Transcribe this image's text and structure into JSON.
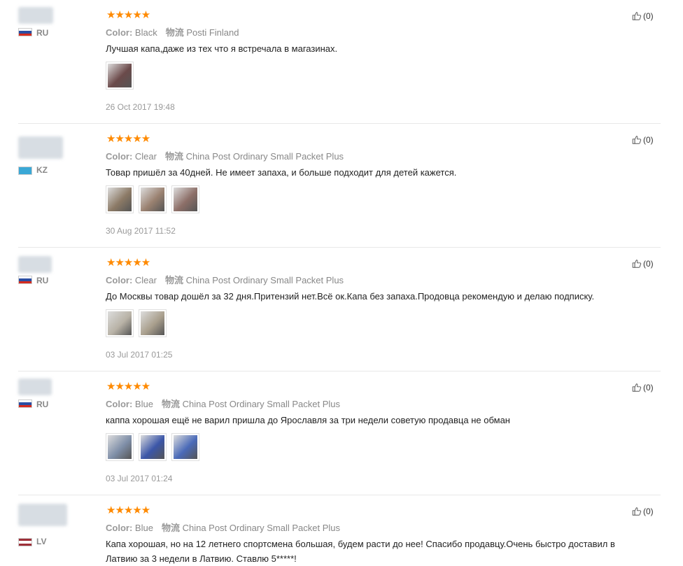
{
  "labels": {
    "color": "Color:",
    "logistics": "物流"
  },
  "icons": {
    "like": "thumbs-up-icon",
    "star": "star-icon"
  },
  "colors": {
    "star": "#ff8a00"
  },
  "reviews": [
    {
      "country": "RU",
      "flag": [
        "#ffffff",
        "#2a4ea3",
        "#d52b1e"
      ],
      "rating": "★★★★★",
      "color": "Black",
      "shipping": "Posti Finland",
      "text": "Лучшая капа,даже из тех что я встречала в магазинах.",
      "photos": [
        "#6b4a4a"
      ],
      "date": "26 Oct 2017 19:48",
      "likes": "(0)"
    },
    {
      "country": "KZ",
      "flag": [
        "#3aa8d6",
        "#3aa8d6",
        "#3aa8d6"
      ],
      "rating": "★★★★★",
      "color": "Clear",
      "shipping": "China Post Ordinary Small Packet Plus",
      "text": "Товар пришёл за 40дней. Не имеет запаха, и больше подходит для детей кажется.",
      "photos": [
        "#8c7a66",
        "#9a8170",
        "#8d6f68"
      ],
      "date": "30 Aug 2017 11:52",
      "likes": "(0)"
    },
    {
      "country": "RU",
      "flag": [
        "#ffffff",
        "#2a4ea3",
        "#d52b1e"
      ],
      "rating": "★★★★★",
      "color": "Clear",
      "shipping": "China Post Ordinary Small Packet Plus",
      "text": "До Москвы товар дошёл за 32 дня.Притензий нет.Всё ок.Капа без запаха.Продовца рекомендую и делаю подписку.",
      "photos": [
        "#b8b2a6",
        "#a99f8d"
      ],
      "date": "03 Jul 2017 01:25",
      "likes": "(0)"
    },
    {
      "country": "RU",
      "flag": [
        "#ffffff",
        "#2a4ea3",
        "#d52b1e"
      ],
      "rating": "★★★★★",
      "color": "Blue",
      "shipping": "China Post Ordinary Small Packet Plus",
      "text": "каппа хорошая ещё не варил пришла до Ярославля за три недели советую продавца не обман",
      "photos": [
        "#7f8fa8",
        "#3b56a8",
        "#4a6ab8"
      ],
      "date": "03 Jul 2017 01:24",
      "likes": "(0)"
    },
    {
      "country": "LV",
      "flag": [
        "#9e3039",
        "#ffffff",
        "#9e3039"
      ],
      "rating": "★★★★★",
      "color": "Blue",
      "shipping": "China Post Ordinary Small Packet Plus",
      "text": "Капа хорошая, но на 12 летнего спортсмена большая, будем расти до нее! Спасибо продавцу.Очень быстро доставил в Латвию за 3 недели в Латвию. Ставлю 5*****!",
      "photos": [],
      "date": "",
      "likes": "(0)"
    }
  ]
}
